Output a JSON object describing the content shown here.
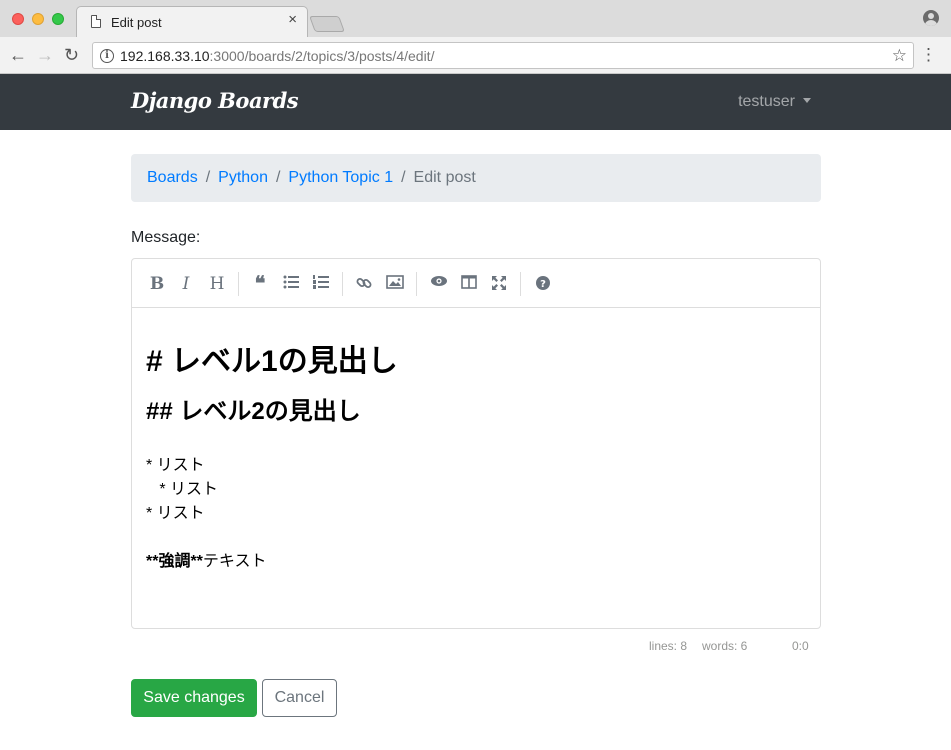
{
  "browser": {
    "tab_title": "Edit post",
    "tab_close": "×",
    "url_host": "192.168.33.10",
    "url_rest": ":3000/boards/2/topics/3/posts/4/edit/",
    "back_glyph": "←",
    "forward_glyph": "→",
    "reload_glyph": "↻",
    "star_glyph": "☆",
    "menu_glyph": "⋮",
    "info_glyph": "i"
  },
  "navbar": {
    "brand": "Django Boards",
    "user": "testuser",
    "background": "#343a40"
  },
  "breadcrumb": {
    "items": [
      "Boards",
      "Python",
      "Python Topic 1"
    ],
    "active": "Edit post",
    "separator": "/"
  },
  "form": {
    "label": "Message:",
    "toolbar_icons": [
      "bold-icon",
      "italic-icon",
      "heading-icon",
      "quote-icon",
      "unordered-list-icon",
      "ordered-list-icon",
      "link-icon",
      "image-icon",
      "preview-icon",
      "side-by-side-icon",
      "fullscreen-icon",
      "help-icon"
    ],
    "toolbar_glyphs": {
      "bold": "B",
      "italic": "I",
      "heading": "H",
      "quote": "❝",
      "help": "?"
    },
    "content": {
      "h1": "# レベル1の見出し",
      "h2": "## レベル2の見出し",
      "lines": [
        "* リスト",
        "   * リスト",
        "* リスト"
      ],
      "strong_markup": "**強調**",
      "strong_tail": "テキスト"
    },
    "status": {
      "lines": "lines: 8",
      "words": "words: 6",
      "cursor": "0:0"
    },
    "save_label": "Save changes",
    "cancel_label": "Cancel",
    "save_color": "#28a745"
  }
}
